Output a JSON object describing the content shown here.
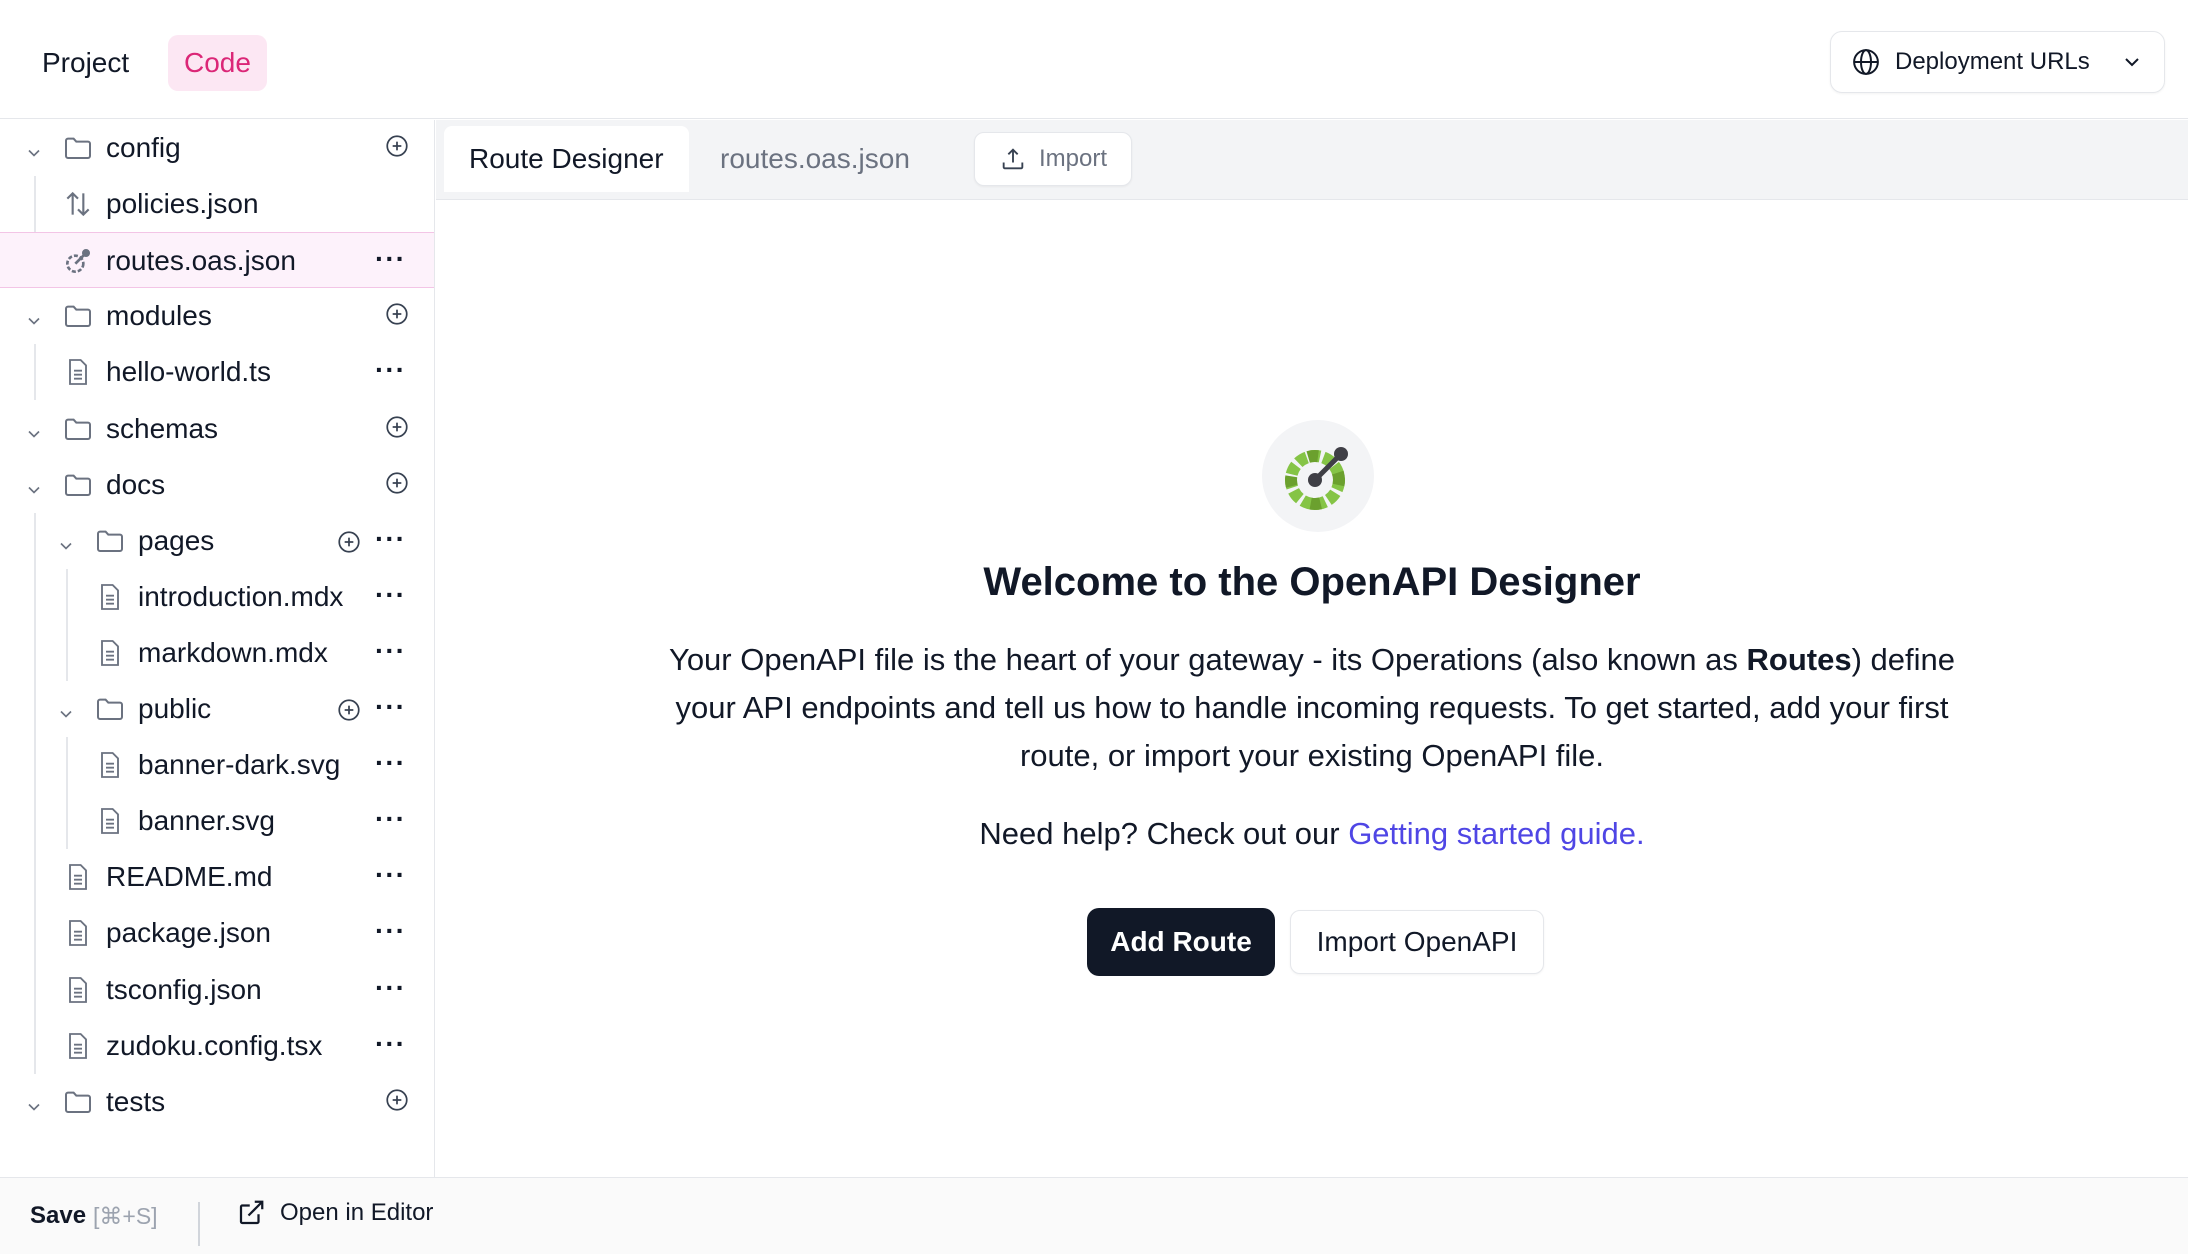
{
  "header": {
    "tabs": [
      {
        "label": "Project",
        "active": false
      },
      {
        "label": "Code",
        "active": true
      }
    ],
    "deployment_button": {
      "label": "Deployment URLs",
      "icon": "globe-icon"
    }
  },
  "sidebar": {
    "items": [
      {
        "name": "config",
        "type": "folder",
        "expanded": true,
        "actions": [
          "add"
        ]
      },
      {
        "name": "policies.json",
        "type": "policies-file",
        "actions": []
      },
      {
        "name": "routes.oas.json",
        "type": "openapi-file",
        "selected": true,
        "actions": [
          "more"
        ]
      },
      {
        "name": "modules",
        "type": "folder",
        "expanded": true,
        "actions": [
          "add"
        ]
      },
      {
        "name": "hello-world.ts",
        "type": "file",
        "actions": [
          "more"
        ]
      },
      {
        "name": "schemas",
        "type": "folder",
        "expanded": true,
        "actions": [
          "add"
        ]
      },
      {
        "name": "docs",
        "type": "folder",
        "expanded": true,
        "actions": [
          "add"
        ]
      },
      {
        "name": "pages",
        "type": "folder",
        "expanded": true,
        "actions": [
          "add",
          "more"
        ]
      },
      {
        "name": "introduction.mdx",
        "type": "file",
        "actions": [
          "more"
        ]
      },
      {
        "name": "markdown.mdx",
        "type": "file",
        "actions": [
          "more"
        ]
      },
      {
        "name": "public",
        "type": "folder",
        "expanded": true,
        "actions": [
          "add",
          "more"
        ]
      },
      {
        "name": "banner-dark.svg",
        "type": "file",
        "actions": [
          "more"
        ]
      },
      {
        "name": "banner.svg",
        "type": "file",
        "actions": [
          "more"
        ]
      },
      {
        "name": "README.md",
        "type": "file",
        "actions": [
          "more"
        ]
      },
      {
        "name": "package.json",
        "type": "file",
        "actions": [
          "more"
        ]
      },
      {
        "name": "tsconfig.json",
        "type": "file",
        "actions": [
          "more"
        ]
      },
      {
        "name": "zudoku.config.tsx",
        "type": "file",
        "actions": [
          "more"
        ]
      },
      {
        "name": "tests",
        "type": "folder",
        "expanded": true,
        "actions": [
          "add"
        ]
      }
    ]
  },
  "footer": {
    "save_label": "Save",
    "save_shortcut": "[⌘+S]",
    "open_editor_label": "Open in Editor"
  },
  "editor": {
    "tabs": [
      {
        "label": "Route Designer",
        "active": true
      },
      {
        "label": "routes.oas.json",
        "active": false
      }
    ],
    "import_label": "Import"
  },
  "welcome": {
    "title": "Welcome to the OpenAPI Designer",
    "desc_before": "Your OpenAPI file is the heart of your gateway - its Operations (also known as ",
    "desc_bold": "Routes",
    "desc_after": ") define your API endpoints and tell us how to handle incoming requests. To get started, add your first route, or import your existing OpenAPI file.",
    "help_prefix": "Need help? Check out our ",
    "help_link": "Getting started guide.",
    "primary_button": "Add Route",
    "secondary_button": "Import OpenAPI"
  },
  "colors": {
    "accent_pink": "#db2777",
    "accent_pink_bg": "#fce7f3",
    "link": "#4f46e5",
    "primary_button_bg": "#111827"
  }
}
